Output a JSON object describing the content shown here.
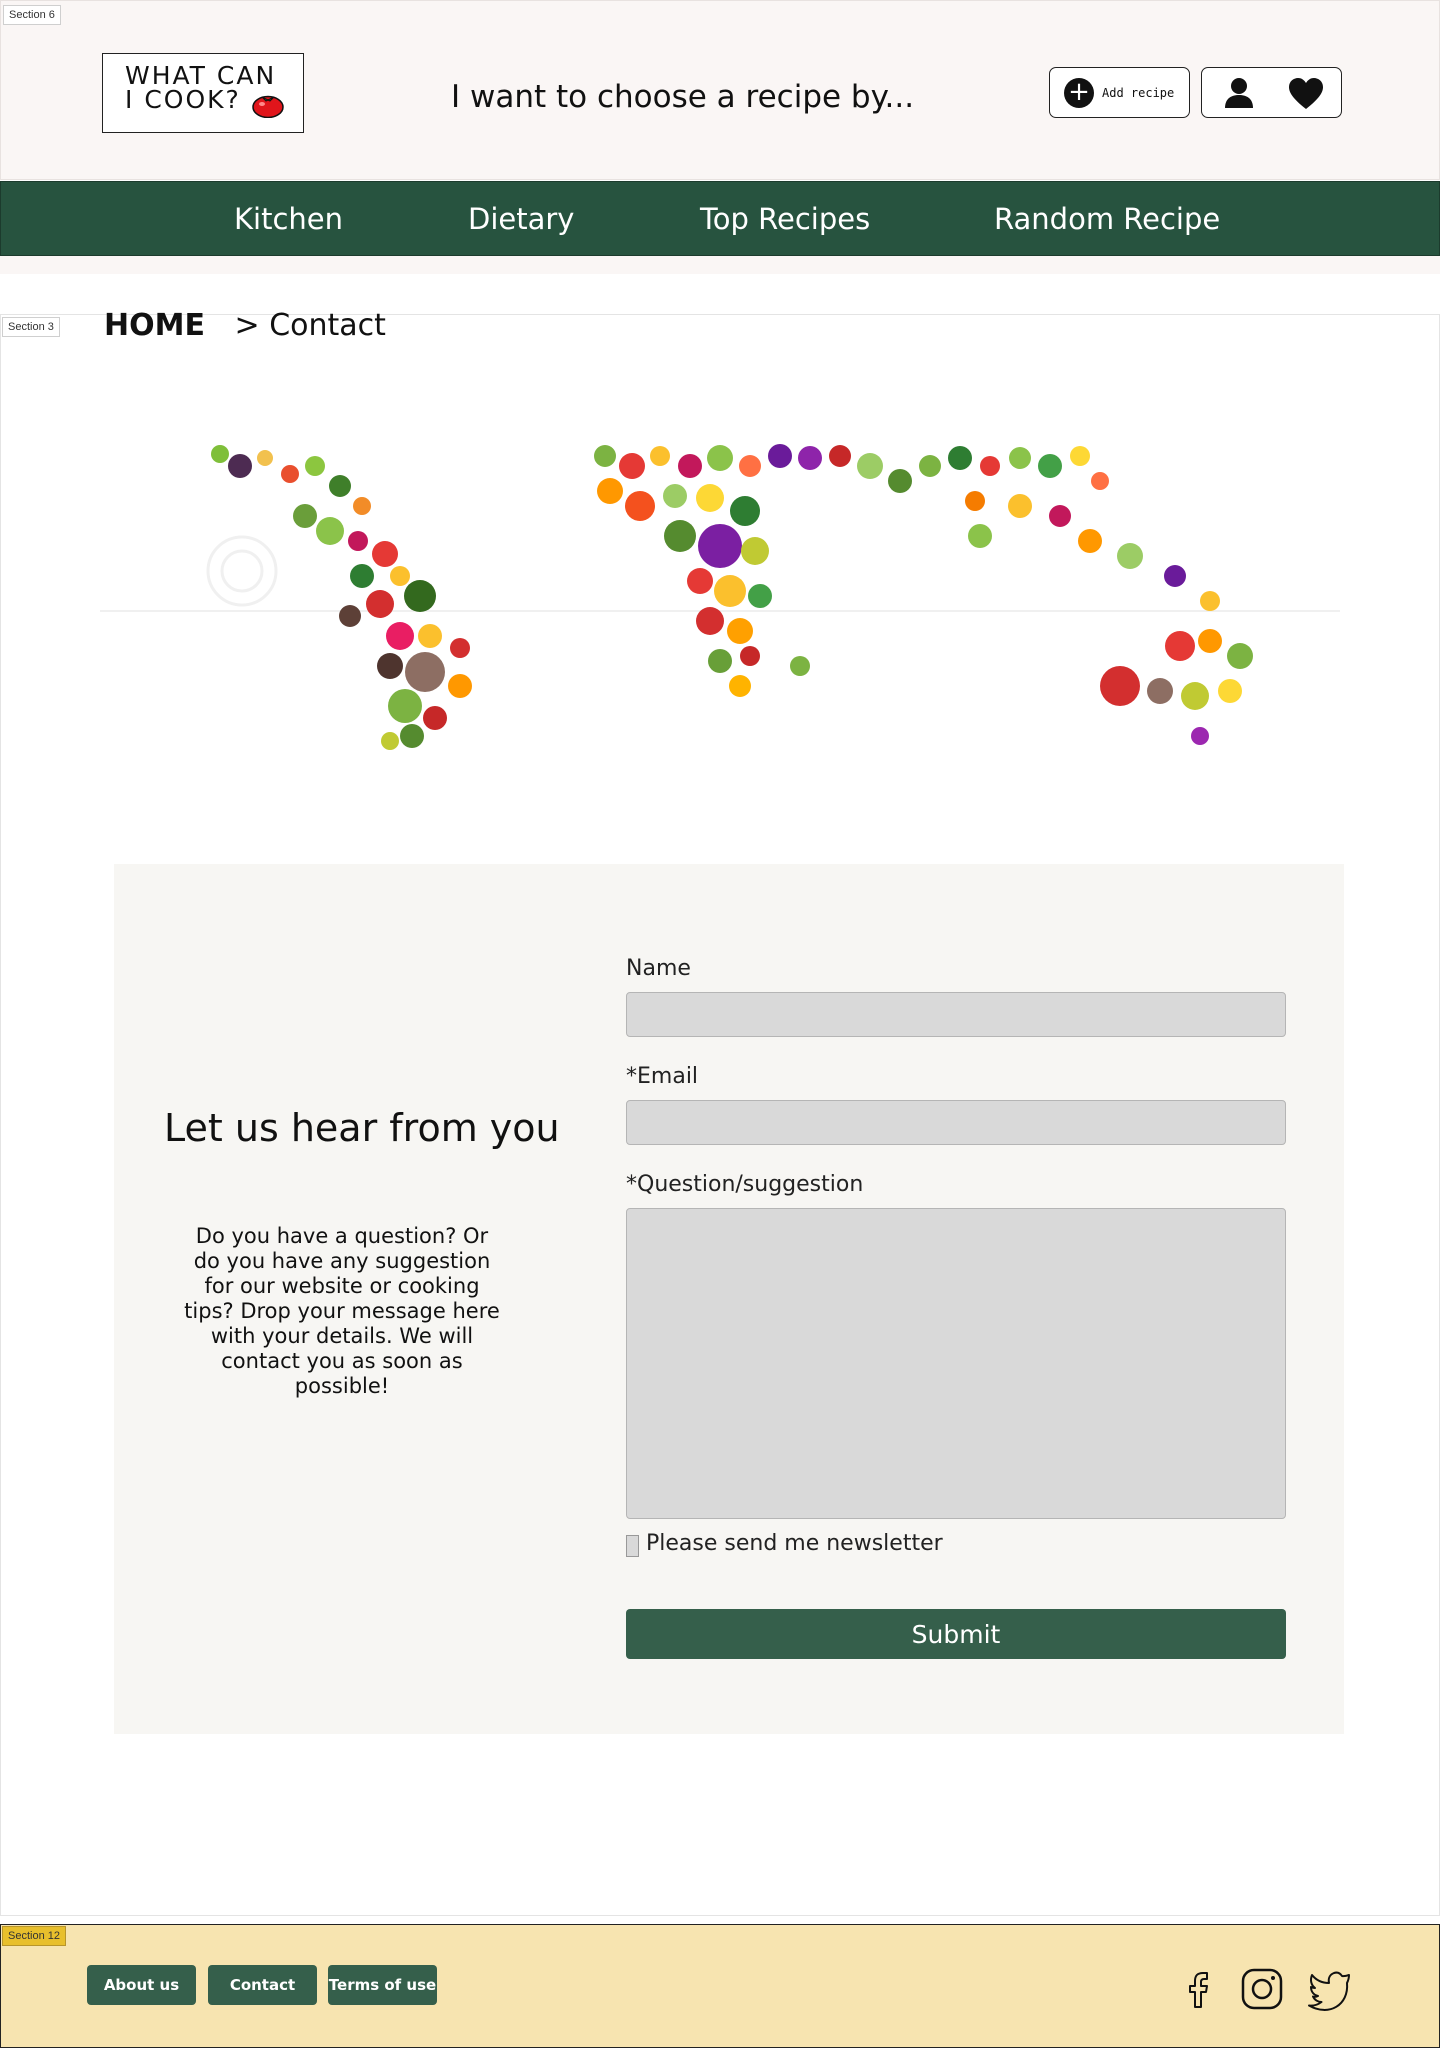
{
  "section_tags": {
    "header": "Section 6",
    "main": "Section 3",
    "footer": "Section 12"
  },
  "header": {
    "logo_line1": "WHAT CAN",
    "logo_line2": "I COOK?",
    "tagline": "I want to choose a recipe by...",
    "add_recipe_label": "Add recipe",
    "icons": [
      "plus-circle-icon",
      "user-icon",
      "heart-icon",
      "tomato-icon"
    ]
  },
  "nav": {
    "items": [
      {
        "label": "Kitchen"
      },
      {
        "label": "Dietary"
      },
      {
        "label": "Top Recipes"
      },
      {
        "label": "Random Recipe"
      }
    ]
  },
  "breadcrumb": {
    "home": "HOME",
    "separator": ">",
    "current": "Contact"
  },
  "contact": {
    "heading": "Let us hear from you",
    "text": "Do you have a question? Or do you have any suggestion for our website or cooking tips? Drop your message here with your details. We will contact you as soon as possible!",
    "name_label": "Name",
    "name_value": "",
    "email_label": "*Email",
    "email_value": "",
    "question_label": "*Question/suggestion",
    "question_value": "",
    "newsletter_label": "Please send me newsletter",
    "newsletter_checked": false,
    "submit_label": "Submit"
  },
  "footer": {
    "links": [
      {
        "label": "About us"
      },
      {
        "label": "Contact"
      },
      {
        "label": "Terms of use"
      }
    ],
    "social_icons": [
      "facebook-icon",
      "instagram-icon",
      "twitter-icon"
    ]
  },
  "colors": {
    "header_bg": "#faf6f5",
    "nav_bg": "#27533f",
    "button_green": "#355f4b",
    "panel_bg": "#f7f6f3",
    "field_bg": "#d9d9d9",
    "footer_bg": "#f7e4b0",
    "tomato_red": "#e0151b"
  }
}
